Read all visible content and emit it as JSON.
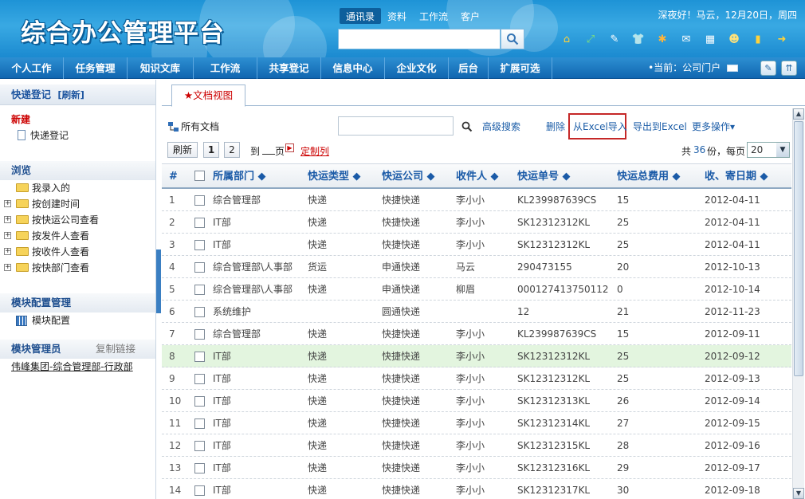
{
  "app": {
    "title": "综合办公管理平台",
    "welcome": "深夜好！马云，12月20日，周四"
  },
  "topnav": [
    "通讯录",
    "资料",
    "工作流",
    "客户"
  ],
  "mainnav": [
    "个人工作",
    "任务管理",
    "知识文库",
    "工作流",
    "共享登记",
    "信息中心",
    "企业文化",
    "后台",
    "扩展可选"
  ],
  "nav_current": "•当前：公司门户",
  "sidebar": {
    "title": "快递登记",
    "refresh": "[刷新]",
    "new_head": "新建",
    "new_item": "快递登记",
    "browse_head": "浏览",
    "browse_items": [
      "我录入的",
      "按创建时间",
      "按快运公司查看",
      "按发件人查看",
      "按收件人查看",
      "按快部门查看"
    ],
    "config_head": "模块配置管理",
    "config_item": "模块配置",
    "admin_head": "模块管理员",
    "copy_link": "复制链接",
    "admin_name": "伟峰集团-综合管理部-行政部"
  },
  "tab": "★文档视图",
  "toolbar": {
    "all_docs": "所有文档",
    "advanced": "高级搜索",
    "delete": "删除",
    "import_excel": "从Excel导入",
    "export_excel": "导出到Excel",
    "more": "更多操作▾"
  },
  "pager": {
    "refresh": "刷新",
    "page1": "1",
    "page2": "2",
    "to": "到",
    "page_label": "页",
    "customize": "定制列",
    "total_prefix": "共",
    "total_count": "36",
    "total_suffix": "份，每页",
    "page_size": "20"
  },
  "table": {
    "headers": [
      "#",
      "所属部门 ◆",
      "快运类型 ◆",
      "快运公司 ◆",
      "收件人 ◆",
      "快运单号 ◆",
      "快运总费用 ◆",
      "收、寄日期 ◆"
    ],
    "selected_row": 8,
    "rows": [
      {
        "n": "1",
        "dept": "综合管理部",
        "type": "快递",
        "company": "快捷快递",
        "recipient": "李小小",
        "tracking": "KL239987639CS",
        "fee": "15",
        "date": "2012-04-11"
      },
      {
        "n": "2",
        "dept": "IT部",
        "type": "快递",
        "company": "快捷快递",
        "recipient": "李小小",
        "tracking": "SK12312312KL",
        "fee": "25",
        "date": "2012-04-11"
      },
      {
        "n": "3",
        "dept": "IT部",
        "type": "快递",
        "company": "快捷快递",
        "recipient": "李小小",
        "tracking": "SK12312312KL",
        "fee": "25",
        "date": "2012-04-11"
      },
      {
        "n": "4",
        "dept": "综合管理部\\人事部",
        "type": "货运",
        "company": "申通快递",
        "recipient": "马云",
        "tracking": "290473155",
        "fee": "20",
        "date": "2012-10-13"
      },
      {
        "n": "5",
        "dept": "综合管理部\\人事部",
        "type": "快递",
        "company": "申通快递",
        "recipient": "柳眉",
        "tracking": "000127413750112",
        "fee": "0",
        "date": "2012-10-14"
      },
      {
        "n": "6",
        "dept": "系统维护",
        "type": "",
        "company": "圆通快递",
        "recipient": "",
        "tracking": "12",
        "fee": "21",
        "date": "2012-11-23"
      },
      {
        "n": "7",
        "dept": "综合管理部",
        "type": "快递",
        "company": "快捷快递",
        "recipient": "李小小",
        "tracking": "KL239987639CS",
        "fee": "15",
        "date": "2012-09-11"
      },
      {
        "n": "8",
        "dept": "IT部",
        "type": "快递",
        "company": "快捷快递",
        "recipient": "李小小",
        "tracking": "SK12312312KL",
        "fee": "25",
        "date": "2012-09-12"
      },
      {
        "n": "9",
        "dept": "IT部",
        "type": "快递",
        "company": "快捷快递",
        "recipient": "李小小",
        "tracking": "SK12312312KL",
        "fee": "25",
        "date": "2012-09-13"
      },
      {
        "n": "10",
        "dept": "IT部",
        "type": "快递",
        "company": "快捷快递",
        "recipient": "李小小",
        "tracking": "SK12312313KL",
        "fee": "26",
        "date": "2012-09-14"
      },
      {
        "n": "11",
        "dept": "IT部",
        "type": "快递",
        "company": "快捷快递",
        "recipient": "李小小",
        "tracking": "SK12312314KL",
        "fee": "27",
        "date": "2012-09-15"
      },
      {
        "n": "12",
        "dept": "IT部",
        "type": "快递",
        "company": "快捷快递",
        "recipient": "李小小",
        "tracking": "SK12312315KL",
        "fee": "28",
        "date": "2012-09-16"
      },
      {
        "n": "13",
        "dept": "IT部",
        "type": "快递",
        "company": "快捷快递",
        "recipient": "李小小",
        "tracking": "SK12312316KL",
        "fee": "29",
        "date": "2012-09-17"
      },
      {
        "n": "14",
        "dept": "IT部",
        "type": "快递",
        "company": "快捷快递",
        "recipient": "李小小",
        "tracking": "SK12312317KL",
        "fee": "30",
        "date": "2012-09-18"
      }
    ]
  },
  "icons": {
    "header": [
      "home-icon",
      "arrows-icon",
      "edit-icon",
      "shirt-icon",
      "gear-icon",
      "mail-icon",
      "calendar-icon",
      "users-icon",
      "notebook-icon",
      "exit-icon"
    ],
    "search": "magnifier-icon",
    "all_docs": "tree-icon"
  },
  "colors": {
    "header_blue": "#1e93d6",
    "nav_blue": "#1066b0",
    "link_blue": "#1d5ea8",
    "accent_red": "#c52828",
    "selected_row": "#e3f5df"
  }
}
